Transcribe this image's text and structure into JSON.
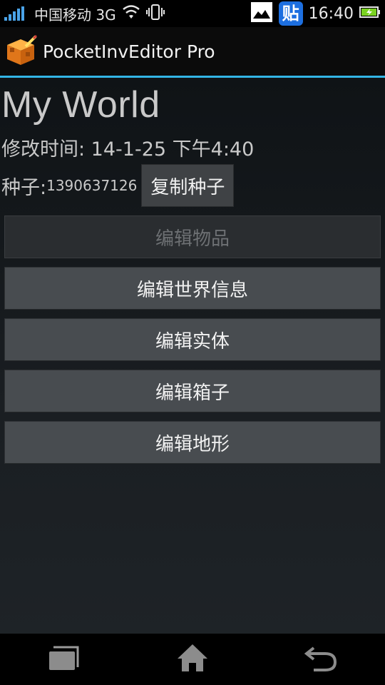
{
  "status_bar": {
    "carrier": "中国移动 3G",
    "tieba_glyph": "贴",
    "time": "16:40",
    "icons": [
      "signal-icon",
      "wifi-icon",
      "vibrate-icon",
      "image-icon",
      "tieba-icon",
      "battery-icon"
    ]
  },
  "action_bar": {
    "app_title": "PocketInvEditor Pro",
    "app_icon": "app-cube-icon"
  },
  "world": {
    "name": "My World",
    "modified": "修改时间: 14-1-25 下午4:40",
    "seed_label": "种子:",
    "seed_value": "1390637126",
    "copy_seed_label": "复制种子"
  },
  "menu": {
    "items": [
      {
        "label": "编辑物品",
        "enabled": false
      },
      {
        "label": "编辑世界信息",
        "enabled": true
      },
      {
        "label": "编辑实体",
        "enabled": true
      },
      {
        "label": "编辑箱子",
        "enabled": true
      },
      {
        "label": "编辑地形",
        "enabled": true
      }
    ]
  },
  "nav_bar": {
    "icons": [
      "recent-apps-icon",
      "home-icon",
      "back-icon"
    ]
  },
  "colors": {
    "accent": "#33b5e5",
    "tieba_blue": "#1d6fe0",
    "signal_blue": "#4aa3e8",
    "battery_green": "#7ad321"
  }
}
